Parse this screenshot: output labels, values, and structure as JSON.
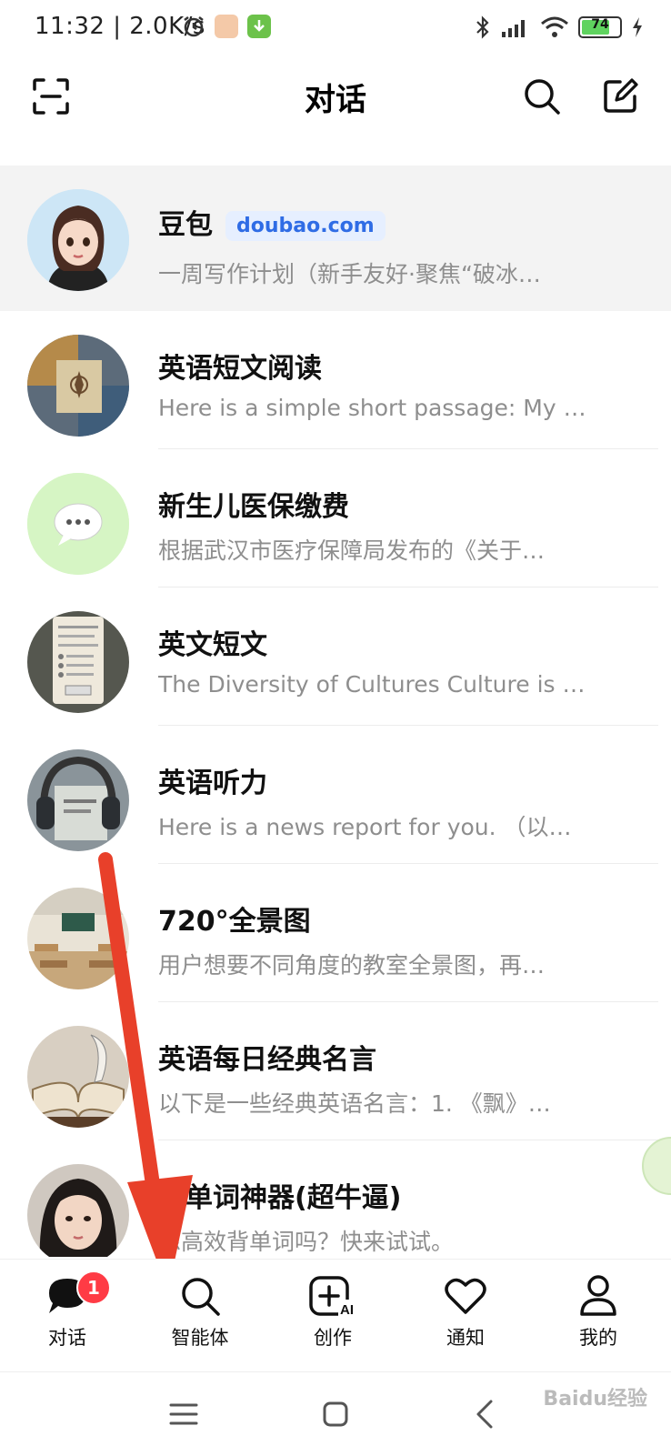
{
  "status_bar": {
    "time": "11:32 | 2.0K/s",
    "battery": "74"
  },
  "header": {
    "title": "对话"
  },
  "conversations": [
    {
      "name": "豆包",
      "tag": "doubao.com",
      "preview": "一周写作计划（新手友好·聚焦“破冰…",
      "avatar": "doubao-avatar"
    },
    {
      "name": "英语短文阅读",
      "preview": "Here is a simple short passage: My …",
      "avatar": "collage-avatar"
    },
    {
      "name": "新生儿医保缴费",
      "preview": "根据武汉市医疗保障局发布的《关于…",
      "avatar": "chat-bubble-avatar"
    },
    {
      "name": "英文短文",
      "preview": "The Diversity of Cultures Culture is …",
      "avatar": "document-avatar"
    },
    {
      "name": "英语听力",
      "preview": "Here is a news report for you. （以…",
      "avatar": "headphones-avatar"
    },
    {
      "name": "720°全景图",
      "preview": "用户想要不同角度的教室全景图，再…",
      "avatar": "classroom-avatar"
    },
    {
      "name": "英语每日经典名言",
      "preview": "以下是一些经典英语名言：1. 《飘》…",
      "avatar": "book-avatar"
    },
    {
      "name": "背单词神器(超牛逼)",
      "preview": "想高效背单词吗？快来试试。",
      "avatar": "girl-avatar"
    }
  ],
  "bottom_nav": {
    "items": [
      {
        "label": "对话",
        "icon": "chat-icon",
        "badge": "1"
      },
      {
        "label": "智能体",
        "icon": "search-icon"
      },
      {
        "label": "创作",
        "icon": "create-ai-icon"
      },
      {
        "label": "通知",
        "icon": "heart-icon"
      },
      {
        "label": "我的",
        "icon": "profile-icon"
      }
    ]
  },
  "watermark": "Baidu经验",
  "colors": {
    "accent": "#2f6ce5",
    "badge": "#ff3b45",
    "arrow": "#e8402a"
  }
}
